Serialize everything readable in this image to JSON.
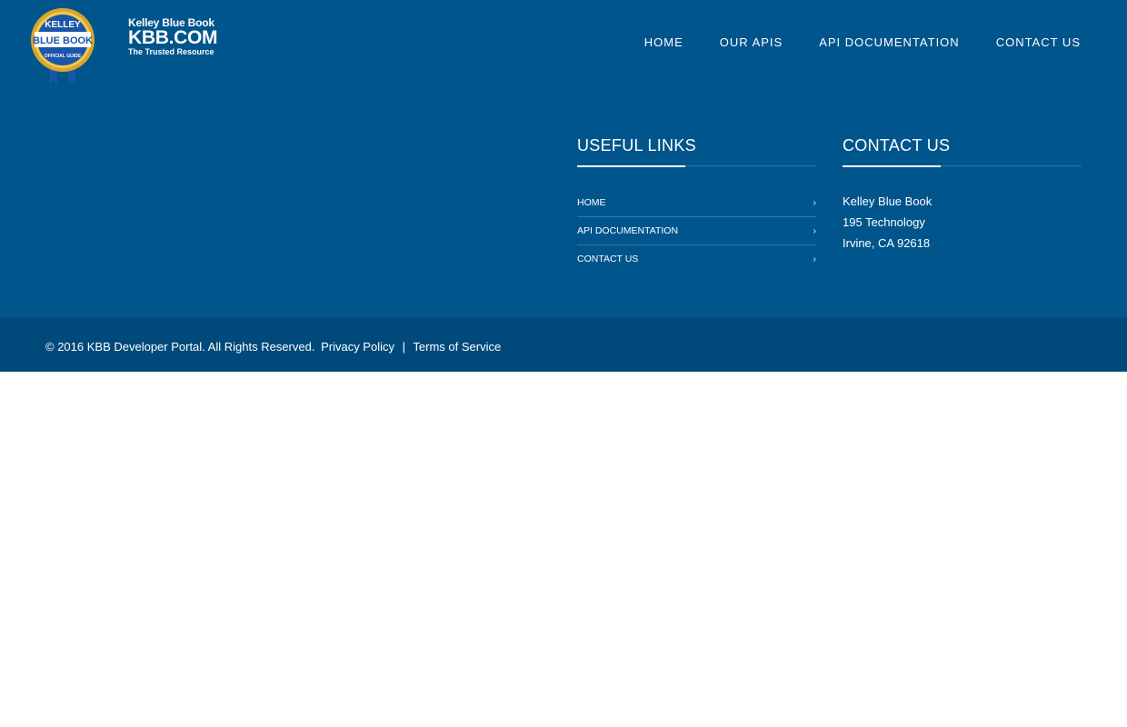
{
  "logo": {
    "line1": "Kelley Blue Book",
    "line2": "KBB.COM",
    "line3": "The Trusted Resource",
    "badge_top": "KELLEY",
    "badge_mid": "BLUE BOOK",
    "badge_bottom": "OFFICIAL GUIDE"
  },
  "nav": {
    "home": "HOME",
    "our_apis": "OUR APIS",
    "api_docs": "API DOCUMENTATION",
    "contact": "CONTACT US"
  },
  "useful_links": {
    "title": "USEFUL LINKS",
    "items": [
      {
        "label": "HOME",
        "icon": "chevron-right-icon"
      },
      {
        "label": "API DOCUMENTATION",
        "icon": "chevron-right-icon"
      },
      {
        "label": "CONTACT US",
        "icon": "chevron-right-icon"
      }
    ]
  },
  "contact_us": {
    "title": "CONTACT US",
    "name": "Kelley Blue Book",
    "street": "195 Technology",
    "city": "Irvine, CA 92618"
  },
  "footer": {
    "copyright": "© 2016 KBB Developer Portal. All Rights Reserved.",
    "privacy": "Privacy Policy",
    "separator": "|",
    "terms": "Terms of Service"
  },
  "colors": {
    "header_bg": "#00558c",
    "footer_bg": "#004a7b",
    "badge_gold": "#d9a62b",
    "badge_blue": "#1a56a8"
  }
}
